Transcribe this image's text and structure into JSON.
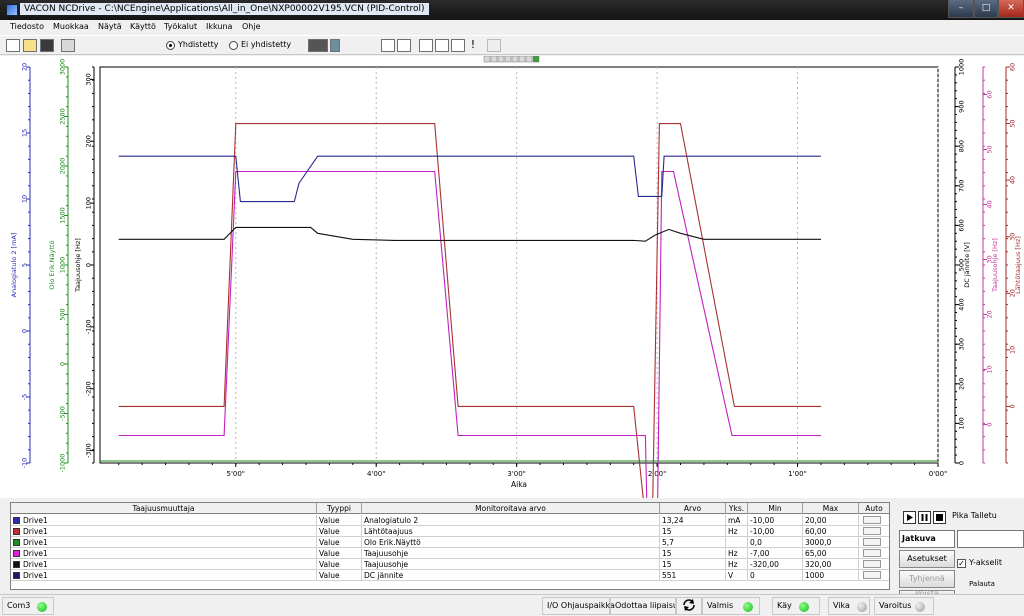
{
  "window": {
    "title": "VACON NCDrive - C:\\NCEngine\\Applications\\All_in_One\\NXP00002V195.VCN (PID-Control)"
  },
  "menu": [
    "Tiedosto",
    "Muokkaa",
    "Näytä",
    "Käyttö",
    "Työkalut",
    "Ikkuna",
    "Ohje"
  ],
  "toolbar": {
    "radio_connected": "Yhdistetty",
    "radio_disconnected": "Ei yhdistetty",
    "icons": [
      "new-file-icon",
      "open-folder-icon",
      "save-icon",
      "print-icon",
      "monitor-icon",
      "upload-icon",
      "download-icon",
      "compare-icon",
      "record-icon",
      "scope-icon",
      "alarm-icon",
      "grid-icon"
    ]
  },
  "chart_data": {
    "type": "line",
    "xlabel": "Aika",
    "x_ticks": [
      "5'00\"",
      "4'00\"",
      "3'00\"",
      "2'00\"",
      "1'00\"",
      "0'00\""
    ],
    "x_reversed": true,
    "grid": true,
    "axes": [
      {
        "side": "left",
        "label": "Analogiatulo 2 [mA]",
        "color": "#2c2cb4",
        "range": [
          -10,
          20
        ],
        "ticks": [
          "-10",
          "-5",
          "0",
          "5",
          "10",
          "15",
          "20"
        ]
      },
      {
        "side": "left",
        "label": "Olo Erik.Näyttö",
        "color": "#1f8f1f",
        "range": [
          -1000,
          3000
        ],
        "ticks": [
          "-1000",
          "-500",
          "0",
          "500",
          "1000",
          "1500",
          "2000",
          "2500",
          "3000"
        ]
      },
      {
        "side": "left",
        "label": "Taajuusohje [Hz]",
        "color": "#000000",
        "range": [
          -320,
          320
        ],
        "ticks": [
          "-300",
          "-200",
          "-100",
          "0",
          "100",
          "200",
          "300"
        ]
      },
      {
        "side": "right",
        "label": "DC jännite [V]",
        "color": "#000000",
        "range": [
          0,
          1000
        ],
        "ticks": [
          "0",
          "100",
          "200",
          "300",
          "400",
          "500",
          "600",
          "700",
          "800",
          "900",
          "1000"
        ]
      },
      {
        "side": "right",
        "label": "Taajuusohje [Hz]",
        "color": "#c0399a",
        "range": [
          -7,
          65
        ],
        "ticks": [
          "0",
          "10",
          "20",
          "30",
          "40",
          "50",
          "60"
        ]
      },
      {
        "side": "right",
        "label": "Lähtötaajuus [Hz]",
        "color": "#a52a2a",
        "range": [
          -10,
          60
        ],
        "ticks": [
          "0",
          "10",
          "20",
          "30",
          "40",
          "50",
          "60"
        ]
      }
    ],
    "series": [
      {
        "name": "Lähtötaajuus",
        "color": "#a83232",
        "unit": "seconds-ago",
        "x": [
          350,
          305,
          300,
          295,
          265,
          215,
          205,
          130,
          125,
          124,
          122,
          119,
          117,
          115,
          110,
          87,
          65,
          55,
          50
        ],
        "y": [
          0,
          0,
          50,
          50,
          50,
          50,
          0,
          0,
          -20,
          -20,
          -20,
          50,
          50,
          50,
          50,
          0,
          0,
          0,
          0
        ]
      },
      {
        "name": "Taajuusohje (pink)",
        "color": "#c21fc2",
        "unit": "seconds-ago",
        "x": [
          350,
          305,
          300,
          265,
          215,
          205,
          130,
          125,
          124,
          120,
          118,
          115,
          113,
          88,
          65,
          55,
          50
        ],
        "y": [
          -2,
          -2,
          46,
          46,
          46,
          -2,
          -2,
          -2,
          -22,
          -22,
          46,
          46,
          46,
          -2,
          -2,
          -2,
          -2
        ]
      },
      {
        "name": "Analogiatulo 2",
        "color": "#2b2b8c",
        "unit": "seconds-ago",
        "x": [
          350,
          300,
          298,
          275,
          273,
          265,
          240,
          130,
          128,
          125,
          118,
          117,
          100,
          50
        ],
        "y": [
          13.24,
          13.24,
          9.8,
          9.8,
          11.2,
          13.24,
          13.24,
          13.24,
          10.2,
          10.2,
          10.2,
          13.24,
          13.24,
          13.24
        ]
      },
      {
        "name": "DC jännite",
        "color": "#111111",
        "unit": "seconds-ago",
        "x": [
          350,
          305,
          300,
          268,
          265,
          250,
          232,
          130,
          125,
          121,
          115,
          110,
          100,
          50
        ],
        "y": [
          565,
          565,
          595,
          595,
          580,
          565,
          562,
          562,
          560,
          575,
          590,
          580,
          565,
          565
        ]
      }
    ]
  },
  "table": {
    "headers": [
      "Taajuusmuuttaja",
      "Tyyppi",
      "Monitoroitava arvo",
      "Arvo",
      "Yks.",
      "Min",
      "Max",
      "Auto"
    ],
    "rows": [
      {
        "color": "#2c2cb4",
        "drive": "Drive1",
        "type": "Value",
        "signal": "Analogiatulo 2",
        "value": "13,24",
        "unit": "mA",
        "min": "-10,00",
        "max": "20,00"
      },
      {
        "color": "#c03030",
        "drive": "Drive1",
        "type": "Value",
        "signal": "Lähtötaajuus",
        "value": "15",
        "unit": "Hz",
        "min": "-10,00",
        "max": "60,00"
      },
      {
        "color": "#1f8f1f",
        "drive": "Drive1",
        "type": "Value",
        "signal": "Olo Erik.Näyttö",
        "value": "5,7",
        "unit": "",
        "min": "0,0",
        "max": "3000,0"
      },
      {
        "color": "#e01fe0",
        "drive": "Drive1",
        "type": "Value",
        "signal": "Taajuusohje",
        "value": "15",
        "unit": "Hz",
        "min": "-7,00",
        "max": "65,00"
      },
      {
        "color": "#111111",
        "drive": "Drive1",
        "type": "Value",
        "signal": "Taajuusohje",
        "value": "15",
        "unit": "Hz",
        "min": "-320,00",
        "max": "320,00"
      },
      {
        "color": "#1a1a6e",
        "drive": "Drive1",
        "type": "Value",
        "signal": "DC jännite",
        "value": "551",
        "unit": "V",
        "min": "0",
        "max": "1000"
      }
    ]
  },
  "controls": {
    "quick_save": "Pika Talletu",
    "mode": "Jatkuva",
    "settings": "Asetukset",
    "clear": "Tyhjennä",
    "delete": "Poista",
    "y_axes": "Y-akselit",
    "reset": "Palauta"
  },
  "status": {
    "port": "Com3",
    "place": "I/O Ohjauspaikka",
    "waiting": "Odottaa liipaisua...",
    "ready": "Valmis",
    "run": "Käy",
    "fault": "Vika",
    "warning": "Varoitus"
  }
}
